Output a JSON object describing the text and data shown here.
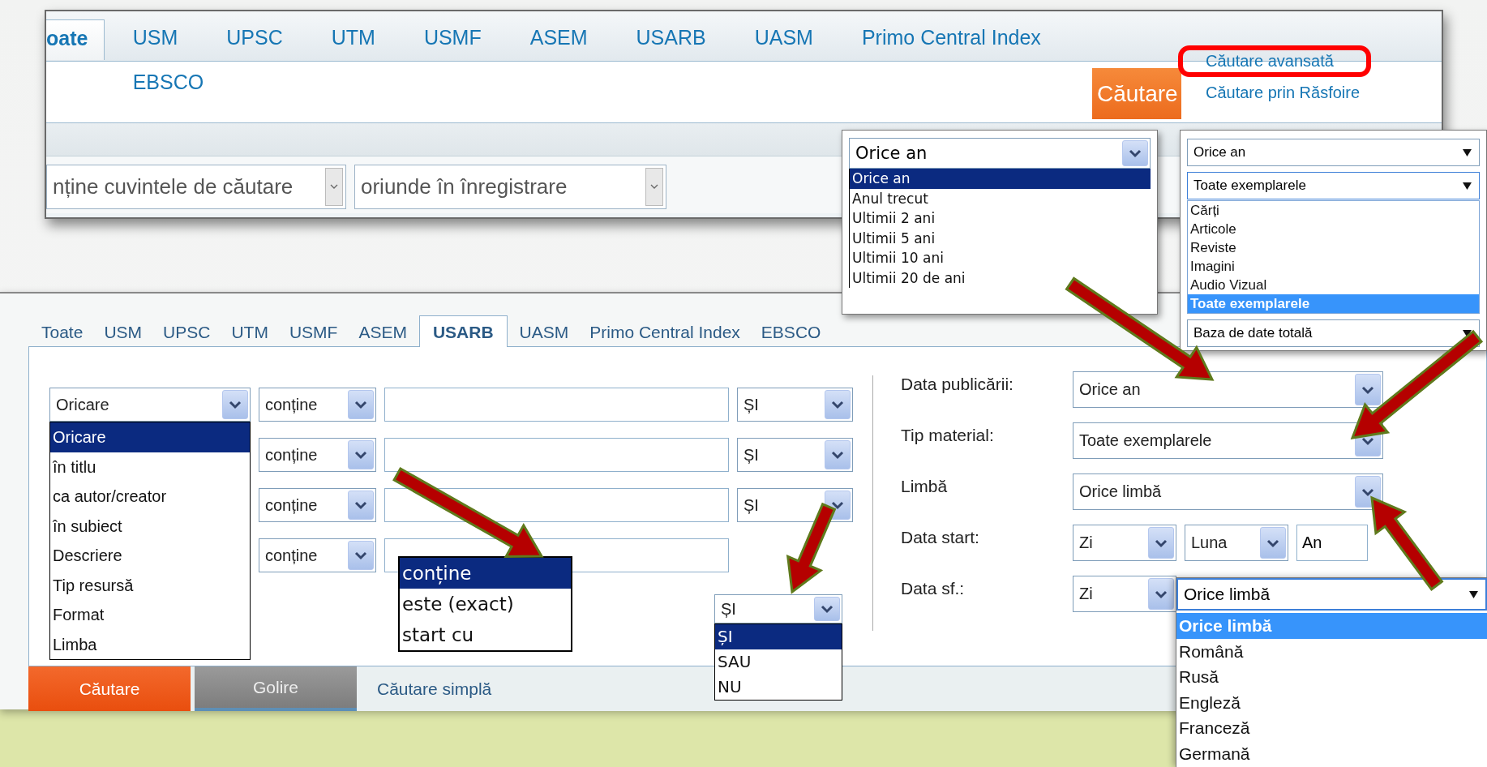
{
  "top_panel": {
    "tabs": [
      {
        "label": "oate",
        "selected": true
      },
      {
        "label": "USM",
        "selected": false
      },
      {
        "label": "UPSC",
        "selected": false
      },
      {
        "label": "UTM",
        "selected": false
      },
      {
        "label": "USMF",
        "selected": false
      },
      {
        "label": "ASEM",
        "selected": false
      },
      {
        "label": "USARB",
        "selected": false
      },
      {
        "label": "UASM",
        "selected": false
      },
      {
        "label": "Primo Central Index",
        "selected": false
      },
      {
        "label": "EBSCO",
        "selected": false
      }
    ],
    "search_button": "Căutare",
    "links": [
      {
        "label": "Căutare avansată",
        "highlighted": true
      },
      {
        "label": "Căutare prin Răsfoire",
        "highlighted": false
      }
    ],
    "selects": [
      {
        "value": "nține cuvintele de căutare"
      },
      {
        "value": "oriunde în înregistrare"
      }
    ]
  },
  "year_dropdown": {
    "value": "Orice an",
    "options": [
      {
        "label": "Orice an",
        "selected": true
      },
      {
        "label": "Anul trecut",
        "selected": false
      },
      {
        "label": "Ultimii 2 ani",
        "selected": false
      },
      {
        "label": "Ultimii 5 ani",
        "selected": false
      },
      {
        "label": "Ultimii 10 ani",
        "selected": false
      },
      {
        "label": "Ultimii 20 de ani",
        "selected": false
      }
    ]
  },
  "material_dropdown": {
    "year_value": "Orice an",
    "value": "Toate exemplarele",
    "options": [
      {
        "label": "Cărți",
        "selected": false
      },
      {
        "label": "Articole",
        "selected": false
      },
      {
        "label": "Reviste",
        "selected": false
      },
      {
        "label": "Imagini",
        "selected": false
      },
      {
        "label": "Audio Vizual",
        "selected": false
      },
      {
        "label": "Toate exemplarele",
        "selected": true
      }
    ],
    "database_value": "Baza de date totală"
  },
  "advanced_search": {
    "tabs": [
      {
        "label": "Toate",
        "selected": false
      },
      {
        "label": "USM",
        "selected": false
      },
      {
        "label": "UPSC",
        "selected": false
      },
      {
        "label": "UTM",
        "selected": false
      },
      {
        "label": "USMF",
        "selected": false
      },
      {
        "label": "ASEM",
        "selected": false
      },
      {
        "label": "USARB",
        "selected": true
      },
      {
        "label": "UASM",
        "selected": false
      },
      {
        "label": "Primo Central Index",
        "selected": false
      },
      {
        "label": "EBSCO",
        "selected": false
      }
    ],
    "field_dropdown": {
      "value": "Oricare",
      "options": [
        {
          "label": "Oricare",
          "selected": true
        },
        {
          "label": "în titlu",
          "selected": false
        },
        {
          "label": "ca autor/creator",
          "selected": false
        },
        {
          "label": "în subiect",
          "selected": false
        },
        {
          "label": "Descriere",
          "selected": false
        },
        {
          "label": "Tip resursă",
          "selected": false
        },
        {
          "label": "Format",
          "selected": false
        },
        {
          "label": "Limba",
          "selected": false
        }
      ]
    },
    "rows": [
      {
        "match": "conține",
        "boolean": "ȘI"
      },
      {
        "match": "conține",
        "boolean": "ȘI"
      },
      {
        "match": "conține",
        "boolean": "ȘI"
      },
      {
        "match": "conține"
      }
    ],
    "match_options": [
      {
        "label": "conține",
        "selected": true
      },
      {
        "label": "este (exact)",
        "selected": false
      },
      {
        "label": "start cu",
        "selected": false
      }
    ],
    "boolean_dropdown": {
      "value": "ȘI",
      "options": [
        {
          "label": "ȘI",
          "selected": true
        },
        {
          "label": "SAU",
          "selected": false
        },
        {
          "label": "NU",
          "selected": false
        }
      ]
    },
    "filters": [
      {
        "label": "Data publicării:",
        "kind": "select",
        "value": "Orice an"
      },
      {
        "label": "Tip material:",
        "kind": "select",
        "value": "Toate exemplarele"
      },
      {
        "label": "Limbă",
        "kind": "select",
        "value": "Orice limbă"
      },
      {
        "label": "Data start:",
        "kind": "date",
        "parts": [
          {
            "kind": "select",
            "value": "Zi"
          },
          {
            "kind": "select",
            "value": "Luna"
          },
          {
            "kind": "field",
            "value": "An"
          }
        ]
      },
      {
        "label": "Data sf.:",
        "kind": "date",
        "parts": [
          {
            "kind": "select",
            "value": "Zi"
          }
        ]
      }
    ],
    "buttons": [
      {
        "label": "Căutare",
        "kind": "primary"
      },
      {
        "label": "Golire",
        "kind": "secondary"
      }
    ],
    "simple_search_link": "Căutare simplă"
  },
  "language_dropdown": {
    "value": "Orice limbă",
    "options": [
      {
        "label": "Orice limbă",
        "selected": true
      },
      {
        "label": "Română",
        "selected": false
      },
      {
        "label": "Rusă",
        "selected": false
      },
      {
        "label": "Engleză",
        "selected": false
      },
      {
        "label": "Franceză",
        "selected": false
      },
      {
        "label": "Germană",
        "selected": false
      }
    ]
  }
}
